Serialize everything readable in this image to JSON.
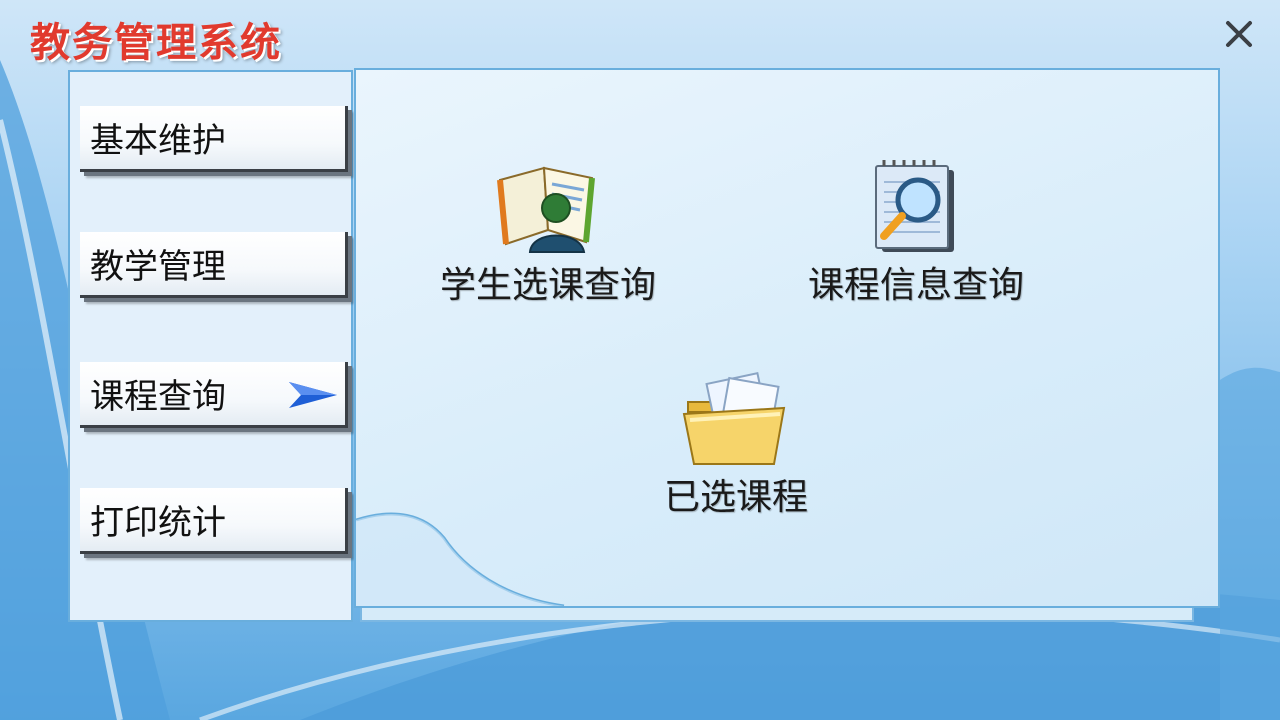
{
  "app": {
    "title": "教务管理系统"
  },
  "window": {
    "close_icon": "close-icon"
  },
  "sidebar": {
    "items": [
      {
        "label": "基本维护"
      },
      {
        "label": "教学管理"
      },
      {
        "label": "课程查询",
        "active": true,
        "icon": "arrow-right-icon"
      },
      {
        "label": "打印统计"
      }
    ]
  },
  "content": {
    "features": [
      {
        "label": "学生选课查询",
        "icon": "student-book-icon"
      },
      {
        "label": "课程信息查询",
        "icon": "magnifier-document-icon"
      },
      {
        "label": "已选课程",
        "icon": "folder-document-icon"
      }
    ]
  },
  "colors": {
    "title": "#e13a2e",
    "accent": "#69aedd",
    "arrow": "#1f5fd6"
  }
}
